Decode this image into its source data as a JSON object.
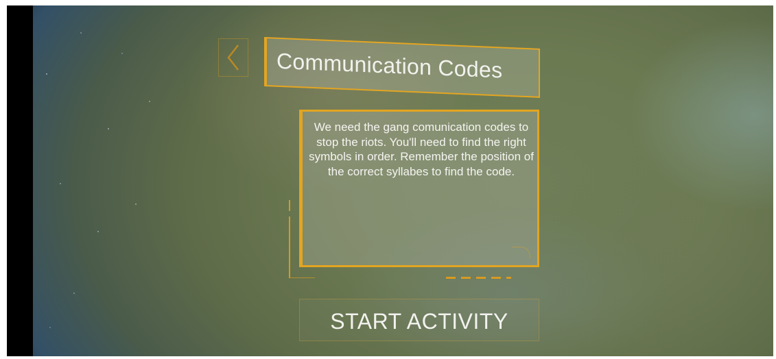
{
  "header": {
    "back_icon": "chevron-left-icon",
    "title": "Communication Codes"
  },
  "briefing": {
    "text": "We need the gang comunication codes to stop the riots. You'll need to find the right symbols in order. Remember the position of the correct syllabes to find the code."
  },
  "actions": {
    "start_label": "START ACTIVITY"
  },
  "colors": {
    "accent": "#e3a521",
    "text": "#f2f2ee"
  }
}
